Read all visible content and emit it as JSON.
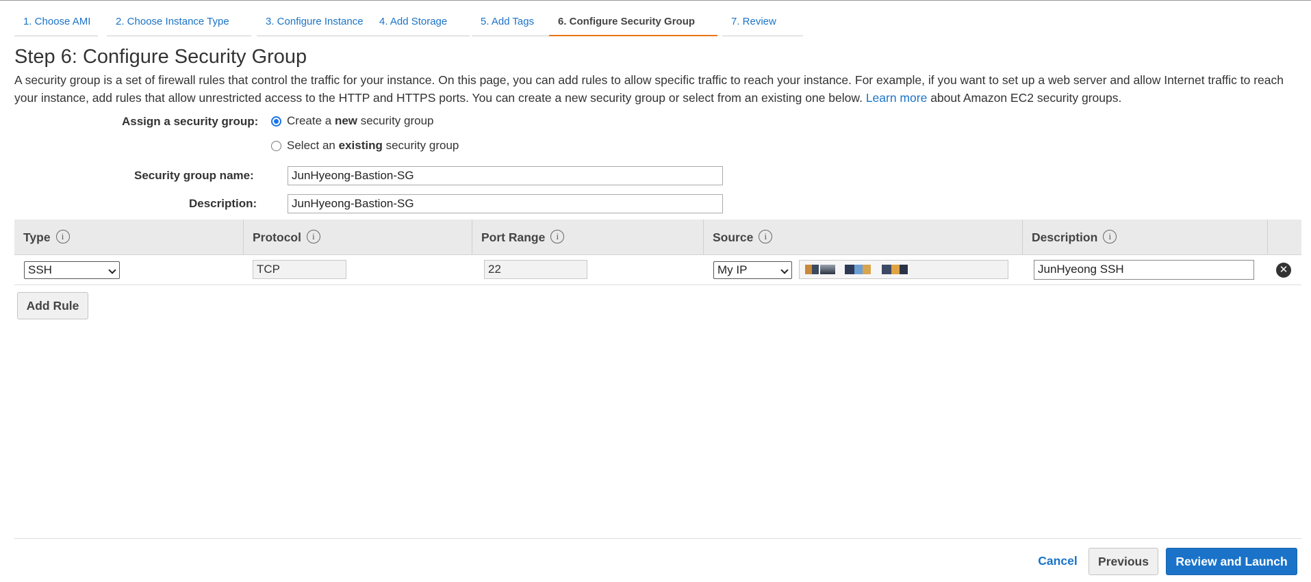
{
  "wizard": {
    "steps": [
      {
        "label": "1. Choose AMI"
      },
      {
        "label": "2. Choose Instance Type"
      },
      {
        "label": "3. Configure Instance"
      },
      {
        "label": "4. Add Storage"
      },
      {
        "label": "5. Add Tags"
      },
      {
        "label": "6. Configure Security Group"
      },
      {
        "label": "7. Review"
      }
    ],
    "active_step": 6,
    "active_color": "#ec7211",
    "link_color": "#1a73c8"
  },
  "page": {
    "title": "Step 6: Configure Security Group",
    "intro_text": "A security group is a set of firewall rules that control the traffic for your instance. On this page, you can add rules to allow specific traffic to reach your instance. For example, if you want to set up a web server and allow Internet traffic to reach your instance, add rules that allow unrestricted access to the HTTP and HTTPS ports. You can create a new security group or select from an existing one below.",
    "learn_more_link": "Learn more",
    "learn_more_suffix": "about Amazon EC2 security groups."
  },
  "form": {
    "assign_label": "Assign a security group:",
    "option_create": {
      "prefix": "Create a ",
      "bold": "new",
      "suffix": " security group",
      "selected": true
    },
    "option_existing": {
      "prefix": "Select an ",
      "bold": "existing",
      "suffix": " security group",
      "selected": false
    },
    "name_label": "Security group name:",
    "name_value": "JunHyeong-Bastion-SG",
    "description_label": "Description:",
    "description_value": "JunHyeong-Bastion-SG"
  },
  "rules_table": {
    "columns": [
      "Type",
      "Protocol",
      "Port Range",
      "Source",
      "Description"
    ],
    "info_icon": "i",
    "rows": [
      {
        "type": "SSH",
        "protocol": "TCP",
        "port_range": "22",
        "source": "My IP",
        "description": "JunHyeong SSH",
        "remove_icon": "✕"
      }
    ]
  },
  "actions": {
    "add_rule": "Add Rule",
    "cancel": "Cancel",
    "previous": "Previous",
    "review_and_launch": "Review and Launch",
    "primary_color": "#1a73c8"
  }
}
